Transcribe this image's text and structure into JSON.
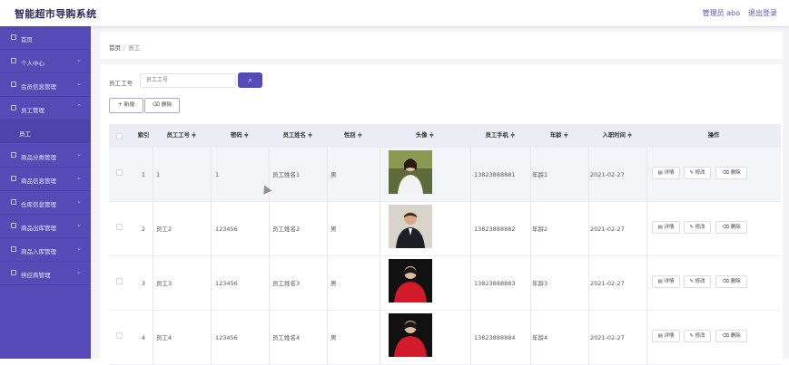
{
  "header": {
    "title": "智能超市导购系统",
    "admin": "管理员 abo",
    "logout": "退出登录"
  },
  "sidebar": {
    "items": [
      {
        "label": "首页",
        "icon": "home-icon"
      },
      {
        "label": "个人中心",
        "icon": "user-icon"
      },
      {
        "label": "会员信息管理",
        "icon": "member-icon"
      },
      {
        "label": "员工管理",
        "icon": "staff-icon"
      },
      {
        "label": "商品分类管理",
        "icon": "category-icon"
      },
      {
        "label": "商品信息管理",
        "icon": "goods-icon"
      },
      {
        "label": "仓库信息管理",
        "icon": "warehouse-icon"
      },
      {
        "label": "商品出库管理",
        "icon": "outbound-icon"
      },
      {
        "label": "商品入库管理",
        "icon": "inbound-icon"
      },
      {
        "label": "供应商管理",
        "icon": "supplier-icon"
      }
    ],
    "sub_item": "员工"
  },
  "breadcrumb": {
    "home": "首页",
    "separator": "/",
    "current": "员工"
  },
  "search": {
    "label": "员工工号",
    "placeholder": "员工工号"
  },
  "buttons": {
    "add": "+ 新增",
    "delete": "删除"
  },
  "table": {
    "headers": [
      "索引",
      "员工工号 ≑",
      "密码 ≑",
      "员工姓名 ≑",
      "性别 ≑",
      "头像 ≑",
      "员工手机 ≑",
      "年龄 ≑",
      "入职时间 ≑",
      "操作"
    ],
    "rows": [
      {
        "index": "1",
        "id": "1",
        "password": "1",
        "name": "员工姓名1",
        "gender": "男",
        "phone": "13823888881",
        "age": "年龄1",
        "date": "2021-02-27"
      },
      {
        "index": "2",
        "id": "员工2",
        "password": "123456",
        "name": "员工姓名2",
        "gender": "男",
        "phone": "13823888882",
        "age": "年龄2",
        "date": "2021-02-27"
      },
      {
        "index": "3",
        "id": "员工3",
        "password": "123456",
        "name": "员工姓名3",
        "gender": "男",
        "phone": "13823888883",
        "age": "年龄3",
        "date": "2021-02-27"
      },
      {
        "index": "4",
        "id": "员工4",
        "password": "123456",
        "name": "员工姓名4",
        "gender": "男",
        "phone": "13823888884",
        "age": "年龄4",
        "date": "2021-02-27"
      }
    ],
    "actions": {
      "detail": "详情",
      "edit": "修改",
      "delete": "删除"
    }
  },
  "colors": {
    "sidebar": "#544bb6",
    "accent": "#5b50c9"
  }
}
